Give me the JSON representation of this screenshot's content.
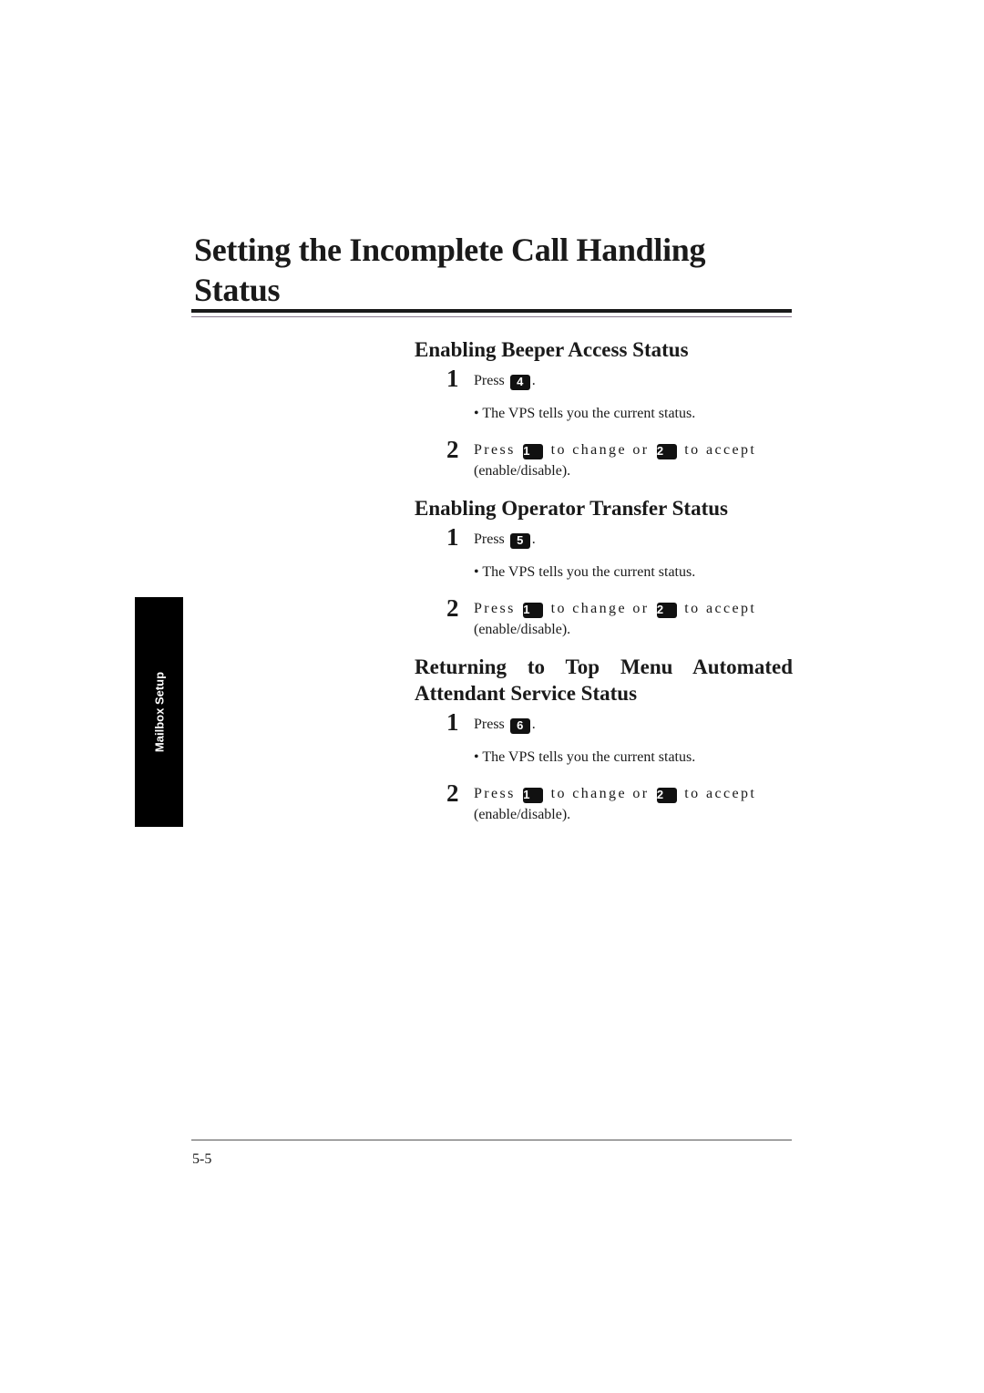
{
  "page": {
    "title": "Setting the Incomplete Call Handling Status",
    "side_tab": "Mailbox Setup",
    "page_number": "5-5"
  },
  "sections": [
    {
      "heading": "Enabling Beeper Access Status",
      "step1": {
        "num": "1",
        "prefix": "Press",
        "key": "4",
        "suffix": "."
      },
      "bullet": "• The VPS tells you the current status.",
      "step2": {
        "num": "2",
        "prefix": "Press",
        "key_a": "1",
        "middle": "to change or",
        "key_b": "2",
        "suffix": "to accept",
        "line2": "(enable/disable)."
      }
    },
    {
      "heading": "Enabling Operator Transfer Status",
      "step1": {
        "num": "1",
        "prefix": "Press",
        "key": "5",
        "suffix": "."
      },
      "bullet": "• The VPS tells you the current status.",
      "step2": {
        "num": "2",
        "prefix": "Press",
        "key_a": "1",
        "middle": "to change or",
        "key_b": "2",
        "suffix": "to accept",
        "line2": "(enable/disable)."
      }
    },
    {
      "heading": "Returning to Top Menu Automated Attendant Service Status",
      "step1": {
        "num": "1",
        "prefix": "Press",
        "key": "6",
        "suffix": "."
      },
      "bullet": "• The VPS tells you the current status.",
      "step2": {
        "num": "2",
        "prefix": "Press",
        "key_a": "1",
        "middle": "to change or",
        "key_b": "2",
        "suffix": "to accept",
        "line2": "(enable/disable)."
      }
    }
  ]
}
